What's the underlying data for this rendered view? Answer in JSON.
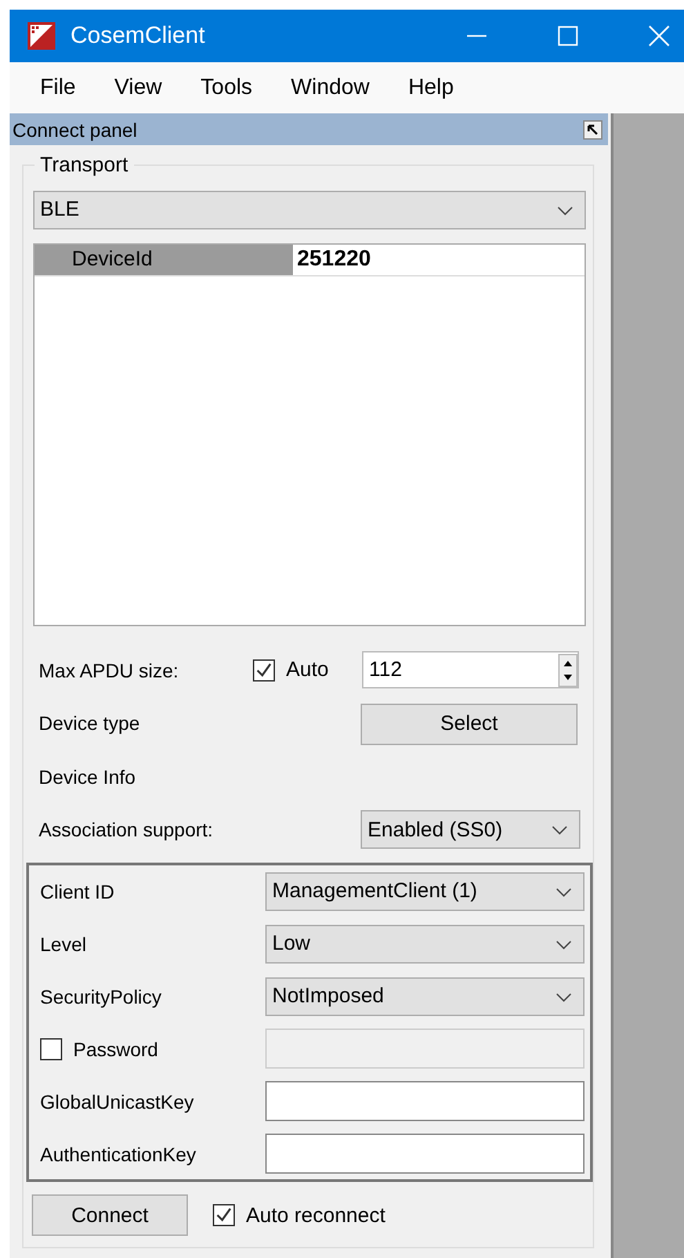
{
  "window": {
    "title": "CosemClient"
  },
  "menu": [
    {
      "label": "File"
    },
    {
      "label": "View"
    },
    {
      "label": "Tools"
    },
    {
      "label": "Window"
    },
    {
      "label": "Help"
    }
  ],
  "panel": {
    "title": "Connect panel",
    "transport": {
      "label": "Transport",
      "value": "BLE"
    },
    "properties": [
      {
        "name": "DeviceId",
        "value": "251220"
      }
    ],
    "max_apdu": {
      "label": "Max APDU size:",
      "auto_label": "Auto",
      "auto_checked": true,
      "value": "112"
    },
    "device_type": {
      "label": "Device type",
      "button": "Select"
    },
    "device_info": {
      "label": "Device Info"
    },
    "association": {
      "label": "Association support:",
      "value": "Enabled (SS0)"
    },
    "security": [
      {
        "kind": "select",
        "label": "Client ID",
        "value": "ManagementClient (1)"
      },
      {
        "kind": "select",
        "label": "Level",
        "value": "Low"
      },
      {
        "kind": "select",
        "label": "SecurityPolicy",
        "value": "NotImposed"
      },
      {
        "kind": "check",
        "label": "Password",
        "checked": false
      },
      {
        "kind": "text",
        "label": "GlobalUnicastKey"
      },
      {
        "kind": "text",
        "label": "AuthenticationKey"
      }
    ],
    "connect_button": "Connect",
    "auto_reconnect": {
      "label": "Auto reconnect",
      "checked": true
    }
  }
}
